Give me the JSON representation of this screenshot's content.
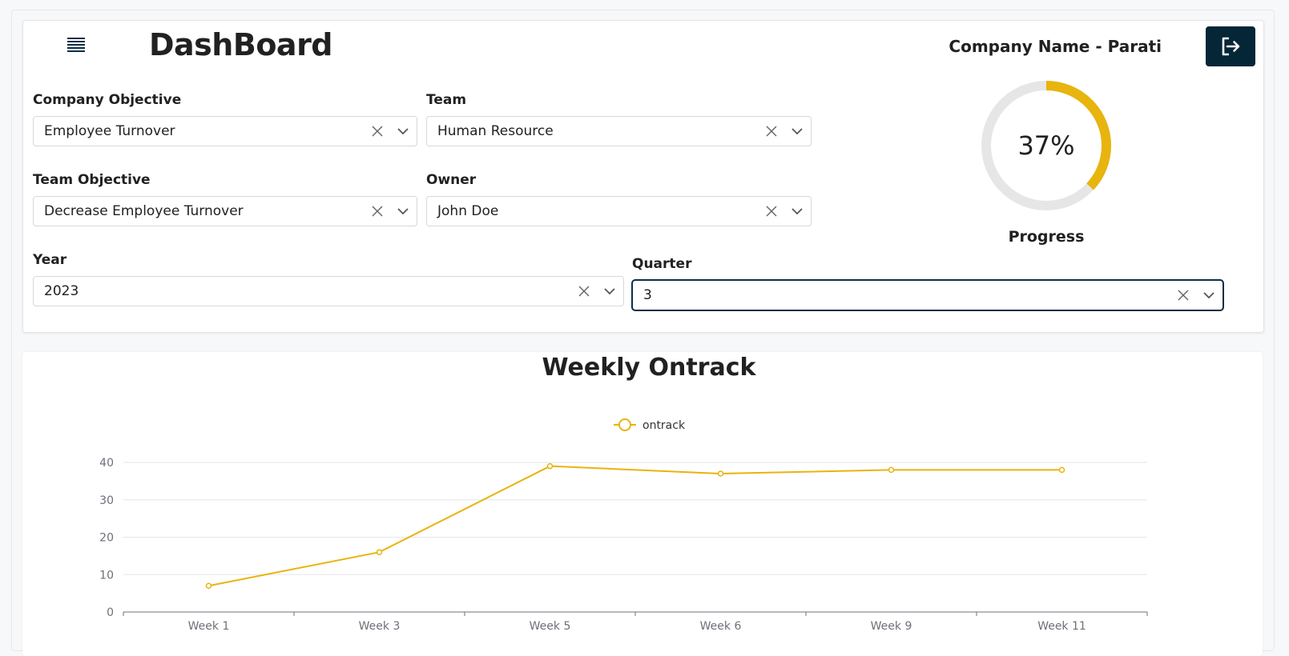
{
  "header": {
    "title": "DashBoard",
    "company": "Company Name - Parati"
  },
  "filters": {
    "company_objective": {
      "label": "Company Objective",
      "value": "Employee Turnover"
    },
    "team": {
      "label": "Team",
      "value": "Human Resource"
    },
    "team_objective": {
      "label": "Team Objective",
      "value": "Decrease Employee Turnover"
    },
    "owner": {
      "label": "Owner",
      "value": "John Doe"
    },
    "year": {
      "label": "Year",
      "value": "2023"
    },
    "quarter": {
      "label": "Quarter",
      "value": "3"
    }
  },
  "progress": {
    "value_text": "37%",
    "fraction": 0.37,
    "label": "Progress",
    "color": "#e8b40e",
    "track_color": "#e6e6e6"
  },
  "colors": {
    "accent": "#e8b40e",
    "primary_dark": "#052636"
  },
  "icons": {
    "menu": "menu-icon",
    "logout": "logout-icon",
    "clear": "close-icon",
    "dropdown": "chevron-down-icon"
  },
  "chart_data": {
    "type": "line",
    "title": "Weekly Ontrack",
    "categories": [
      "Week 1",
      "Week 3",
      "Week 5",
      "Week 6",
      "Week 9",
      "Week 11"
    ],
    "series": [
      {
        "name": "ontrack",
        "values": [
          7,
          16,
          39,
          37,
          38,
          38
        ],
        "color": "#e8b40e"
      }
    ],
    "ylim": [
      0,
      40
    ],
    "yticks": [
      0,
      10,
      20,
      30,
      40
    ],
    "grid": true,
    "legend": "top-center"
  }
}
